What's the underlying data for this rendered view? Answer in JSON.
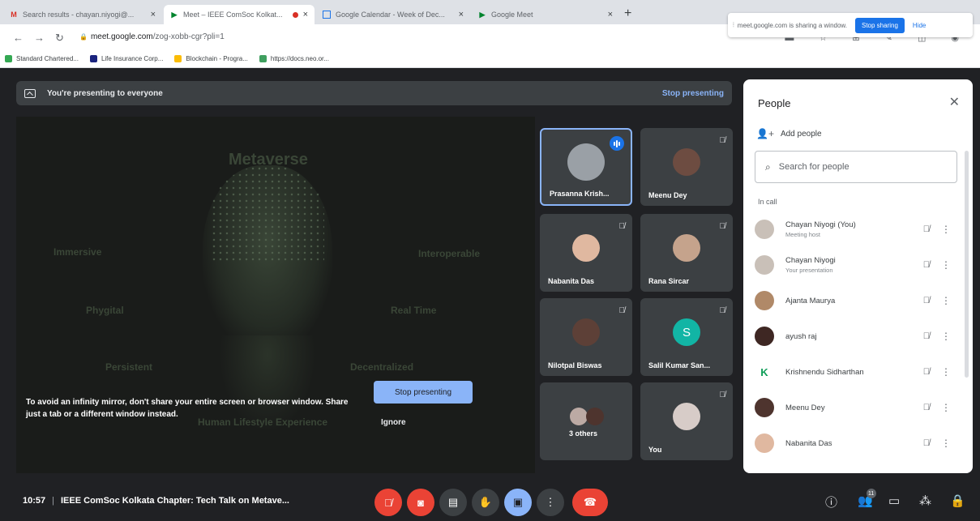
{
  "browser": {
    "tabs": [
      {
        "title": "Search results - chayan.niyogi@...",
        "favicon": "gmail-icon",
        "active": false
      },
      {
        "title": "Meet – IEEE ComSoc Kolkat...",
        "favicon": "meet-icon",
        "active": true,
        "recording": true
      },
      {
        "title": "Google Calendar - Week of Dec...",
        "favicon": "calendar-icon",
        "active": false
      },
      {
        "title": "Google Meet",
        "favicon": "meet-icon",
        "active": false
      }
    ],
    "new_tab": "+",
    "url_host": "meet.google.com",
    "url_path": "/zog-xobb-cgr?pli=1",
    "sharing_notice": "meet.google.com is sharing a window.",
    "stop_sharing": "Stop sharing",
    "hide": "Hide",
    "bookmarks": [
      {
        "label": "Standard Chartered...",
        "color": "#34a853"
      },
      {
        "label": "Life Insurance Corp...",
        "color": "#1a237e"
      },
      {
        "label": "Blockchain - Progra...",
        "color": "#fbbc04"
      },
      {
        "label": "https://docs.neo.or...",
        "color": "#3f9f5f"
      }
    ]
  },
  "meet": {
    "presenting_banner": "You're presenting to everyone",
    "stop_presenting_link": "Stop presenting",
    "slide_words": {
      "title": "Metaverse",
      "left1": "Immersive",
      "left2": "Phygital",
      "left3": "Persistent",
      "right1": "Interoperable",
      "right2": "Real Time",
      "right3": "Decentralized",
      "bottom": "Human Lifestyle Experience"
    },
    "warning": "To avoid an infinity mirror, don't share your entire screen or browser window. Share just a tab or a different window instead.",
    "stop_presenting_btn": "Stop presenting",
    "ignore_btn": "Ignore",
    "tiles": [
      {
        "name": "Prasanna Krish...",
        "avatar_color": "#9aa0a6",
        "speaking": true
      },
      {
        "name": "Meenu Dey",
        "avatar_color": "#6d4c41",
        "speaking": false
      },
      {
        "name": "Nabanita Das",
        "avatar_color": "#e0b8a0",
        "speaking": false
      },
      {
        "name": "Rana Sircar",
        "avatar_color": "#c5a38c",
        "speaking": false
      },
      {
        "name": "Nilotpal Biswas",
        "avatar_color": "#5d4037",
        "speaking": false
      },
      {
        "name": "Salil Kumar San...",
        "avatar_color": "#12b5a5",
        "initial": "S",
        "speaking": false
      },
      {
        "name": "3 others",
        "avatar_color": "#bcaaa4",
        "speaking": false
      },
      {
        "name": "You",
        "avatar_color": "#d7ccc8",
        "speaking": false
      }
    ]
  },
  "people_panel": {
    "title": "People",
    "add_people": "Add people",
    "search_placeholder": "Search for people",
    "section": "In call",
    "rows": [
      {
        "name": "Chayan Niyogi (You)",
        "sub": "Meeting host",
        "avatar_color": "#c9c0b8"
      },
      {
        "name": "Chayan Niyogi",
        "sub": "Your presentation",
        "avatar_color": "#c9c0b8"
      },
      {
        "name": "Ajanta Maurya",
        "sub": "",
        "avatar_color": "#b08968"
      },
      {
        "name": "ayush raj",
        "sub": "",
        "avatar_color": "#3e2723"
      },
      {
        "name": "Krishnendu Sidharthan",
        "sub": "",
        "avatar_color": "#ffffff",
        "initial": "K",
        "initial_color": "#0f9d58"
      },
      {
        "name": "Meenu Dey",
        "sub": "",
        "avatar_color": "#4e342e"
      },
      {
        "name": "Nabanita Das",
        "sub": "",
        "avatar_color": "#e0b8a0"
      }
    ]
  },
  "bottom": {
    "time": "10:57",
    "meeting_title": "IEEE ComSoc Kolkata Chapter: Tech Talk on Metave...",
    "people_count": "11"
  }
}
